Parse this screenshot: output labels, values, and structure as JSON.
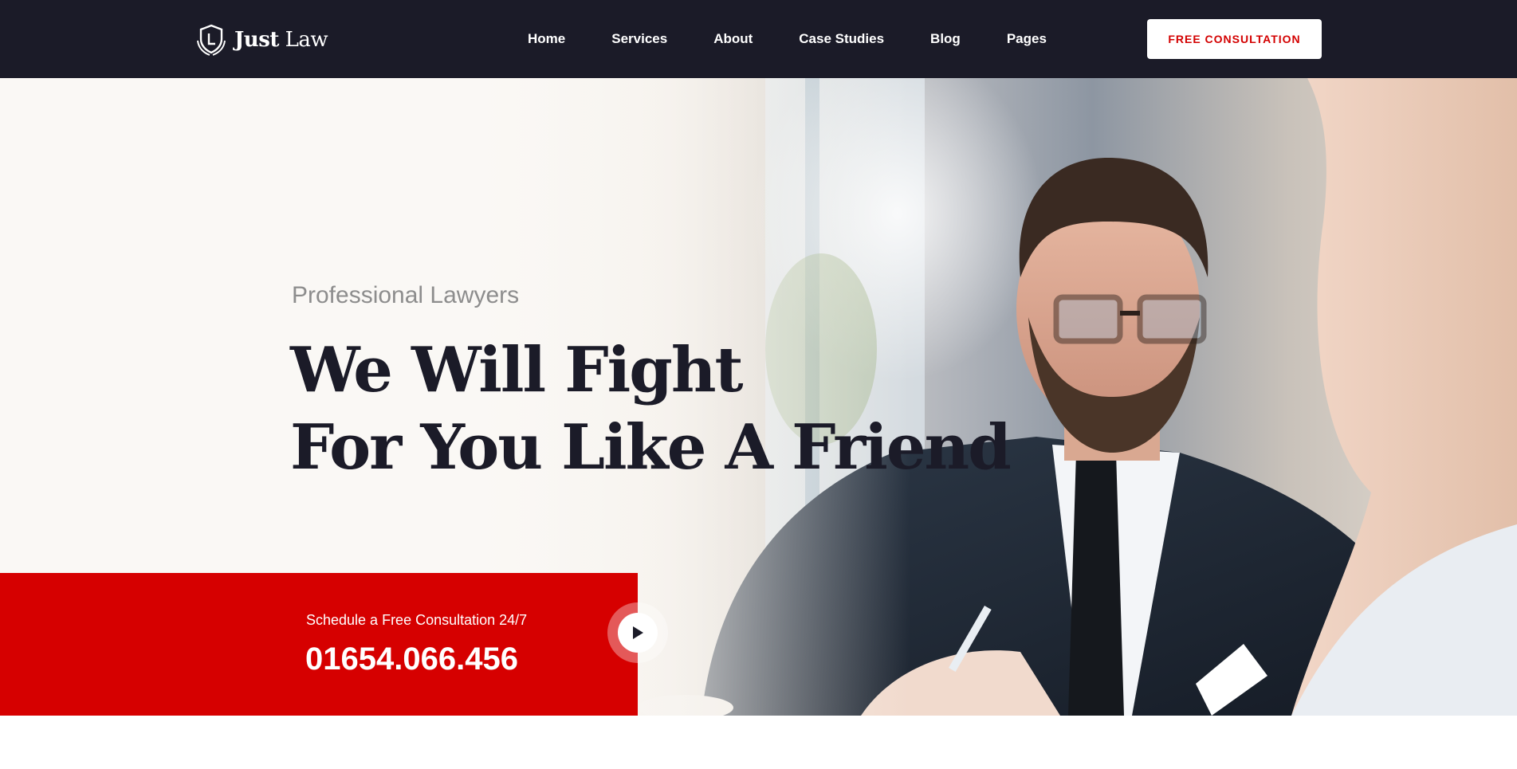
{
  "header": {
    "logo": {
      "icon": "shield-l-icon",
      "brand_bold": "Just",
      "brand_light": "Law"
    },
    "nav": [
      {
        "label": "Home"
      },
      {
        "label": "Services"
      },
      {
        "label": "About"
      },
      {
        "label": "Case Studies"
      },
      {
        "label": "Blog"
      },
      {
        "label": "Pages"
      }
    ],
    "cta_label": "FREE CONSULTATION"
  },
  "hero": {
    "subtitle": "Professional Lawyers",
    "headline_line1": "We Will Fight",
    "headline_line2": "For You Like A Friend",
    "consult": {
      "label": "Schedule a Free Consultation 24/7",
      "phone": "01654.066.456"
    },
    "play_icon": "play-icon",
    "photo": "lawyer-consultation-photo"
  },
  "colors": {
    "header_bg": "#1b1b28",
    "accent_red": "#d60000",
    "headline": "#1b1b28",
    "subtitle": "#8d8d8d"
  }
}
